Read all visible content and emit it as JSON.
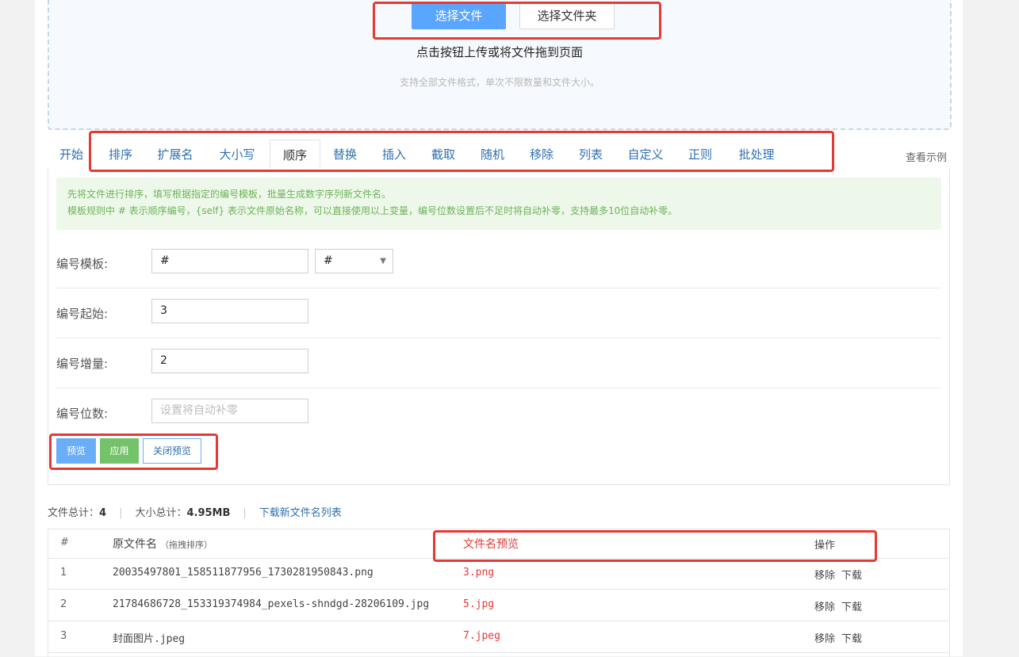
{
  "upload": {
    "select_file_label": "选择文件",
    "select_folder_label": "选择文件夹",
    "title": "点击按钮上传或将文件拖到页面",
    "hint": "支持全部文件格式，单次不限数量和文件大小。"
  },
  "tabs": {
    "items": [
      "开始",
      "排序",
      "扩展名",
      "大小写",
      "顺序",
      "替换",
      "插入",
      "截取",
      "随机",
      "移除",
      "列表",
      "自定义",
      "正则",
      "批处理"
    ],
    "active": "顺序",
    "example_link": "查看示例"
  },
  "notice": {
    "line1": "先将文件进行排序，填写根据指定的编号模板，批量生成数字序列新文件名。",
    "line2": "模板规则中 # 表示顺序编号，{self} 表示文件原始名称，可以直接使用以上变量，编号位数设置后不足时将自动补零，支持最多10位自动补零。"
  },
  "form": {
    "template": {
      "label": "编号模板:",
      "value": "#",
      "select_value": "#"
    },
    "start": {
      "label": "编号起始:",
      "value": "3"
    },
    "step": {
      "label": "编号增量:",
      "value": "2"
    },
    "digits": {
      "label": "编号位数:",
      "placeholder": "设置将自动补零"
    }
  },
  "actions": {
    "preview_label": "预览",
    "apply_label": "应用",
    "close_preview_label": "关闭预览"
  },
  "stats": {
    "file_total_label": "文件总计：",
    "file_total_value": "4",
    "size_total_label": "大小总计：",
    "size_total_value": "4.95MB",
    "download_list_link": "下载新文件名列表"
  },
  "table": {
    "headers": {
      "index": "#",
      "original": "原文件名",
      "original_sub": "（拖拽排序）",
      "preview": "文件名预览",
      "ops": "操作"
    },
    "rows": [
      {
        "index": "1",
        "original": "20035497801_158511877956_1730281950843.png",
        "preview": "3.png",
        "remove": "移除",
        "download": "下载"
      },
      {
        "index": "2",
        "original": "21784686728_153319374984_pexels-shndgd-28206109.jpg",
        "preview": "5.jpg",
        "remove": "移除",
        "download": "下载"
      },
      {
        "index": "3",
        "original": "封面图片.jpeg",
        "preview": "7.jpeg",
        "remove": "移除",
        "download": "下载"
      }
    ]
  },
  "colors": {
    "primary": "#58a6ff",
    "success": "#74c26a",
    "link": "#2f6fb0",
    "highlight": "#e53935",
    "preview_text": "#e53935"
  }
}
